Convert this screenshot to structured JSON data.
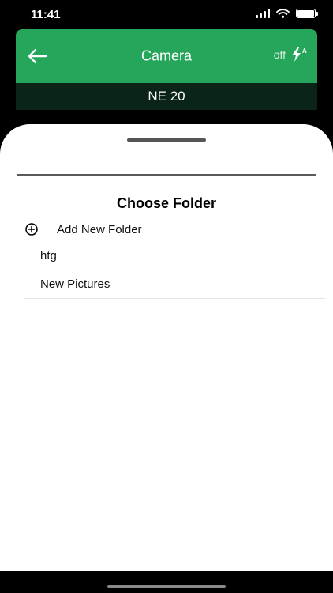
{
  "status_bar": {
    "time": "11:41"
  },
  "header": {
    "title": "Camera",
    "flash_state": "off",
    "flash_mode_letter": "A",
    "subtitle": "NE 20"
  },
  "sheet": {
    "title": "Choose Folder",
    "add_label": "Add New Folder",
    "folders": [
      {
        "label": "htg"
      },
      {
        "label": "New Pictures"
      }
    ]
  },
  "colors": {
    "header_green": "#26a65b",
    "subheader_dark": "#0b2418",
    "sheet_background": "#ffffff"
  },
  "icons": {
    "back": "arrow-left-icon",
    "flash": "flash-auto-icon",
    "add": "plus-circle-icon",
    "wifi": "wifi-icon",
    "signal": "cellular-signal-icon",
    "battery": "battery-icon"
  }
}
